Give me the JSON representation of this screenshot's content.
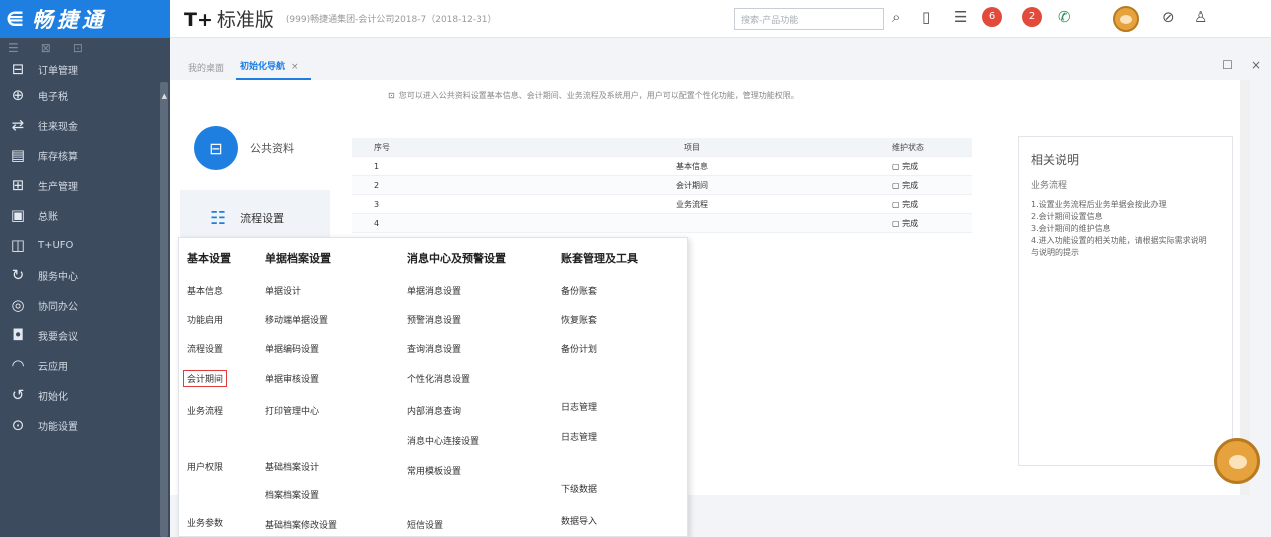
{
  "brand": {
    "back": "⋹",
    "name": "畅捷通"
  },
  "sidebar": {
    "tools": [
      "☰",
      "⊠",
      "⊡"
    ],
    "items": [
      {
        "icon": "⊟",
        "label": "订单管理"
      },
      {
        "icon": "⊕",
        "label": "电子税"
      },
      {
        "icon": "⇄",
        "label": "往来现金"
      },
      {
        "icon": "▤",
        "label": "库存核算"
      },
      {
        "icon": "⊞",
        "label": "生产管理"
      },
      {
        "icon": "▣",
        "label": "总账"
      },
      {
        "icon": "◫",
        "label": "T+UFO"
      },
      {
        "icon": "↻",
        "label": "服务中心"
      },
      {
        "icon": "◎",
        "label": "协同办公"
      },
      {
        "icon": "◘",
        "label": "我要会议"
      },
      {
        "icon": "◠",
        "label": "云应用"
      },
      {
        "icon": "↺",
        "label": "初始化"
      },
      {
        "icon": "⊙",
        "label": "功能设置"
      }
    ]
  },
  "header": {
    "logo": "T+",
    "edition": "标准版",
    "company": "(999)畅捷通集团-会计公司2018-7（2018-12-31）",
    "search_placeholder": "搜索-产品功能",
    "badge_a": "6",
    "badge_b": "2"
  },
  "tabs": {
    "home": "我的桌面",
    "init": "初始化导航",
    "close": "×"
  },
  "window": {
    "restore": "☐",
    "close": "×"
  },
  "hint": "您可以进入公共资料设置基本信息、会计期间、业务流程及系统用户，用户可以配置个性化功能，管理功能权限。",
  "cards": {
    "public": "公共资料",
    "process": "流程设置"
  },
  "table": {
    "headers": {
      "no": "序号",
      "item": "项目",
      "status": "维护状态"
    },
    "rows": [
      {
        "no": "1",
        "item": "基本信息",
        "status": "完成"
      },
      {
        "no": "2",
        "item": "会计期间",
        "status": "完成"
      },
      {
        "no": "3",
        "item": "业务流程",
        "status": "完成"
      },
      {
        "no": "4",
        "item": "",
        "status": "完成"
      }
    ]
  },
  "notes": {
    "title": "相关说明",
    "sub": "业务流程",
    "lines": [
      "1.设置业务流程后业务单据会按此办理",
      "2.会计期间设置信息",
      "3.会计期间的维护信息",
      "4.进入功能设置的相关功能，请根据实际需求说明",
      "与说明的提示"
    ]
  },
  "menu": {
    "col1": {
      "title": "基本设置",
      "items": [
        "基本信息",
        "功能启用",
        "流程设置",
        "会计期间",
        "业务流程",
        "用户权限",
        "业务参数"
      ]
    },
    "col2": {
      "title": "单据档案设置",
      "items": [
        "单据设计",
        "移动端单据设置",
        "单据编码设置",
        "单据审核设置",
        "打印管理中心",
        "基础档案设计",
        "档案档案设置",
        "基础档案修改设置"
      ]
    },
    "col3": {
      "title": "消息中心及预警设置",
      "items": [
        "单据消息设置",
        "预警消息设置",
        "查询消息设置",
        "个性化消息设置",
        "内部消息查询",
        "消息中心连接设置",
        "常用模板设置",
        "短信设置"
      ]
    },
    "col4": {
      "title": "账套管理及工具",
      "items": [
        "备份账套",
        "恢复账套",
        "备份计划",
        "日志管理",
        "日志管理",
        "下级数据",
        "数据导入"
      ]
    }
  }
}
